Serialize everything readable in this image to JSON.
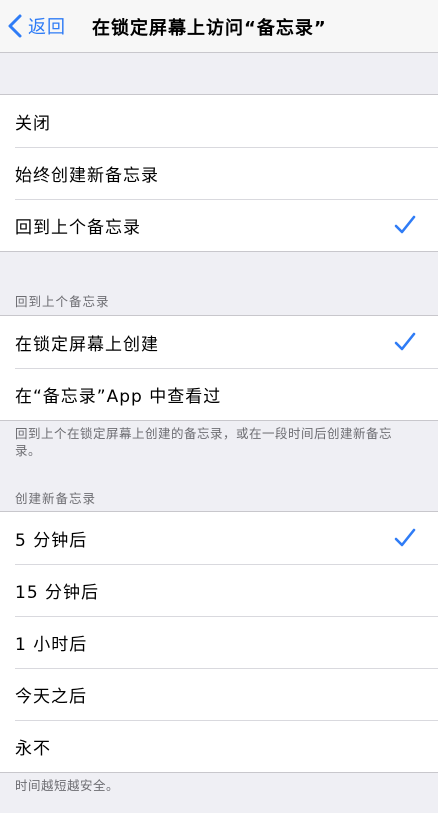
{
  "nav": {
    "back_label": "返回",
    "title": "在锁定屏幕上访问“备忘录”"
  },
  "access_options": {
    "items": [
      {
        "label": "关闭",
        "selected": false
      },
      {
        "label": "始终创建新备忘录",
        "selected": false
      },
      {
        "label": "回到上个备忘录",
        "selected": true
      }
    ]
  },
  "resume_section": {
    "header": "回到上个备忘录",
    "items": [
      {
        "label": "在锁定屏幕上创建",
        "selected": true
      },
      {
        "label": "在“备忘录”App 中查看过",
        "selected": false
      }
    ],
    "footer": "回到上个在锁定屏幕上创建的备忘录，或在一段时间后创建新备忘录。"
  },
  "create_section": {
    "header": "创建新备忘录",
    "items": [
      {
        "label": "5 分钟后",
        "selected": true
      },
      {
        "label": "15 分钟后",
        "selected": false
      },
      {
        "label": "1 小时后",
        "selected": false
      },
      {
        "label": "今天之后",
        "selected": false
      },
      {
        "label": "永不",
        "selected": false
      }
    ],
    "footer": "时间越短越安全。"
  },
  "colors": {
    "accent": "#2f7cf6",
    "background": "#efeff4",
    "secondary_text": "#6d6d72"
  },
  "icons": {
    "back": "chevron-left-icon",
    "selected": "checkmark-icon"
  }
}
